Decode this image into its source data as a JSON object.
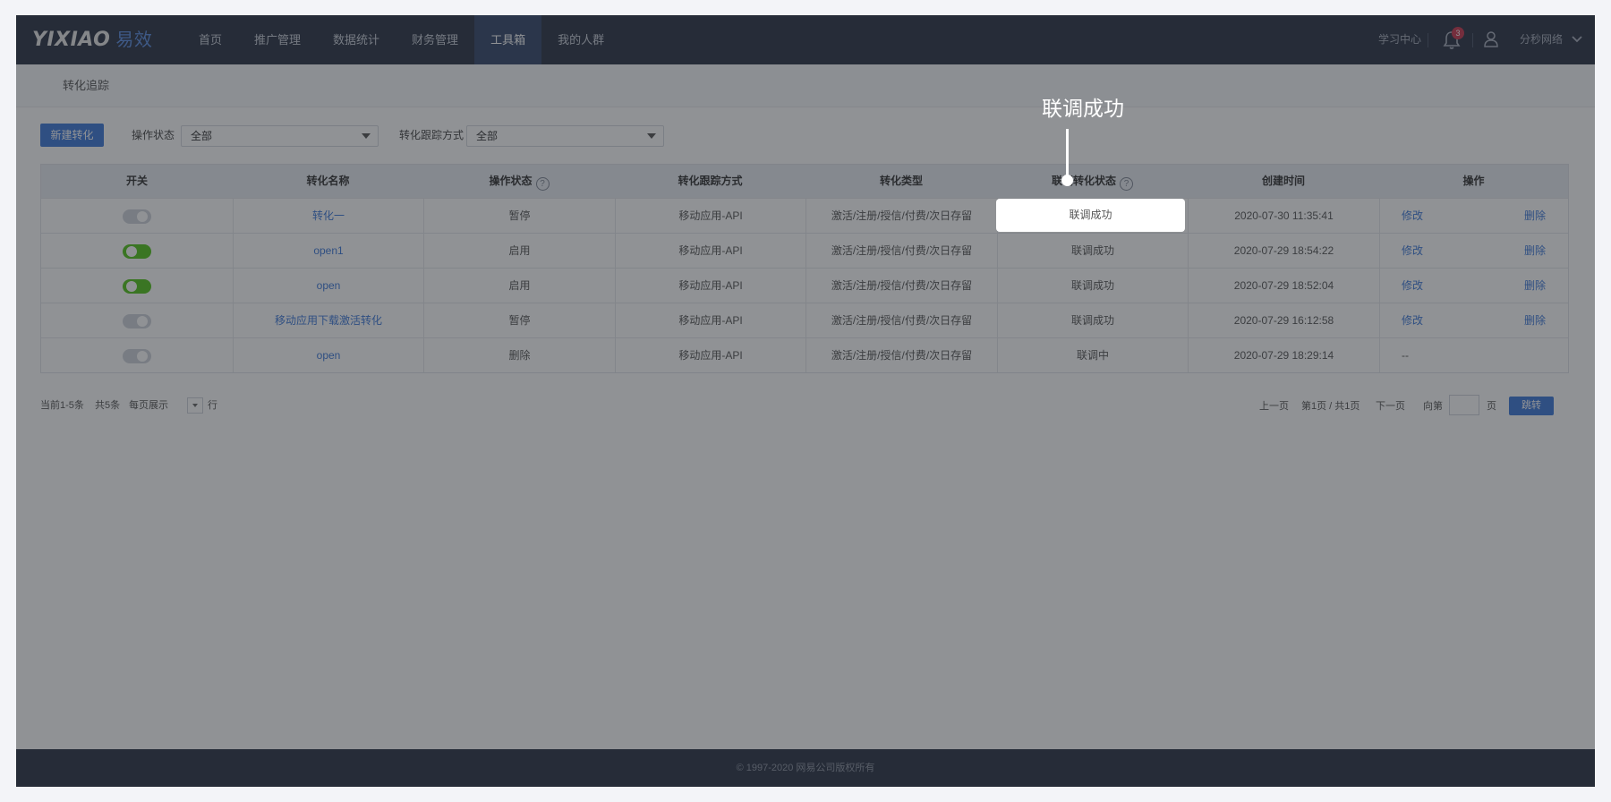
{
  "app": {
    "logo_text": "YIXIAO",
    "logo_cn": "易效"
  },
  "nav": {
    "items": [
      "首页",
      "推广管理",
      "数据统计",
      "财务管理",
      "工具箱",
      "我的人群"
    ],
    "active_index": 4
  },
  "header": {
    "learn_center": "学习中心",
    "notification_count": "3",
    "user_name": "分秒网络"
  },
  "breadcrumb": "转化追踪",
  "filters": {
    "new_button": "新建转化",
    "status_label": "操作状态",
    "status_value": "全部",
    "method_label": "转化跟踪方式",
    "method_value": "全部"
  },
  "table": {
    "columns": [
      "开关",
      "转化名称",
      "操作状态",
      "转化跟踪方式",
      "转化类型",
      "联调转化状态",
      "创建时间",
      "操作"
    ],
    "rows": [
      {
        "switch": "off",
        "name": "转化一",
        "status": "暂停",
        "method": "移动应用-API",
        "type": "激活/注册/授信/付费/次日存留",
        "debug": "联调成功",
        "created": "2020-07-30 11:35:41",
        "edit": "修改",
        "delete": "删除"
      },
      {
        "switch": "on",
        "name": "open1",
        "status": "启用",
        "method": "移动应用-API",
        "type": "激活/注册/授信/付费/次日存留",
        "debug": "联调成功",
        "created": "2020-07-29 18:54:22",
        "edit": "修改",
        "delete": "删除"
      },
      {
        "switch": "on",
        "name": "open",
        "status": "启用",
        "method": "移动应用-API",
        "type": "激活/注册/授信/付费/次日存留",
        "debug": "联调成功",
        "created": "2020-07-29 18:52:04",
        "edit": "修改",
        "delete": "删除"
      },
      {
        "switch": "off",
        "name": "移动应用下载激活转化",
        "status": "暂停",
        "method": "移动应用-API",
        "type": "激活/注册/授信/付费/次日存留",
        "debug": "联调成功",
        "created": "2020-07-29 16:12:58",
        "edit": "修改",
        "delete": "删除"
      },
      {
        "switch": "off",
        "name": "open",
        "status": "删除",
        "method": "移动应用-API",
        "type": "激活/注册/授信/付费/次日存留",
        "debug": "联调中",
        "created": "2020-07-29 18:29:14",
        "edit": "--",
        "delete": ""
      }
    ]
  },
  "pagination": {
    "current": "当前1-5条",
    "total": "共5条",
    "per_page_label": "每页展示",
    "per_page_unit": "行",
    "prev": "上一页",
    "page_info": "第1页 / 共1页",
    "next": "下一页",
    "goto_label": "向第",
    "goto_unit": "页",
    "jump_button": "跳转"
  },
  "footer": "© 1997-2020 网易公司版权所有",
  "annotation": {
    "text": "联调成功",
    "highlight_text": "联调成功"
  },
  "colors": {
    "nav_bg": "#2a3345",
    "primary": "#3d78d8",
    "toggle_on": "#52c41a",
    "badge": "#c9364e"
  }
}
